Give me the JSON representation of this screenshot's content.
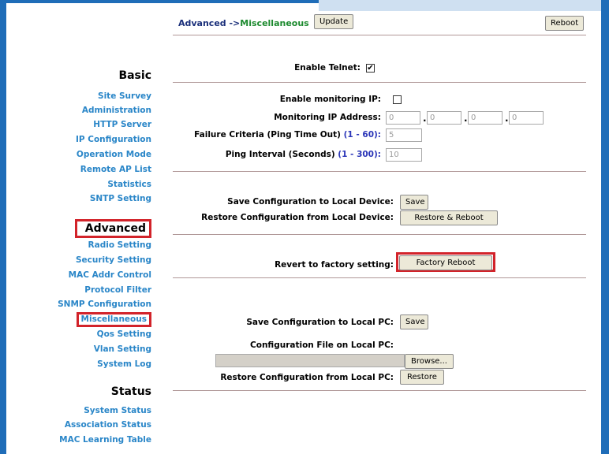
{
  "breadcrumb": {
    "section": "Advanced ->",
    "page": "Miscellaneous"
  },
  "buttons": {
    "update": "Update",
    "reboot": "Reboot",
    "save_local_device": "Save",
    "restore_reboot": "Restore & Reboot",
    "factory_reboot": "Factory Reboot",
    "save_local_pc": "Save",
    "browse": "Browse...",
    "restore": "Restore"
  },
  "sidebar": {
    "basic": {
      "title": "Basic",
      "items": [
        "Site Survey",
        "Administration",
        "HTTP Server",
        "IP Configuration",
        "Operation Mode",
        "Remote AP List",
        "Statistics",
        "SNTP Setting"
      ]
    },
    "advanced": {
      "title": "Advanced",
      "items": [
        "Radio Setting",
        "Security Setting",
        "MAC Addr Control",
        "Protocol Filter",
        "SNMP Configuration",
        "Miscellaneous",
        "Qos Setting",
        "Vlan Setting",
        "System Log"
      ]
    },
    "status": {
      "title": "Status",
      "items": [
        "System Status",
        "Association Status",
        "MAC Learning Table"
      ]
    }
  },
  "telnet": {
    "label": "Enable Telnet:",
    "checked": true,
    "mark": "✔"
  },
  "monitoring": {
    "enable_label": "Enable monitoring IP:",
    "enabled": false,
    "ip_label": "Monitoring IP Address:",
    "ip": [
      "0",
      "0",
      "0",
      "0"
    ],
    "failure_label": "Failure Criteria (Ping Time Out)",
    "failure_range": "(1 - 60):",
    "failure_value": "5",
    "interval_label": "Ping Interval (Seconds)",
    "interval_range": "(1 - 300):",
    "interval_value": "10"
  },
  "device_config": {
    "save_label": "Save Configuration to Local Device:",
    "restore_label": "Restore Configuration from Local Device:"
  },
  "factory": {
    "label": "Revert to factory setting:"
  },
  "pc_config": {
    "save_label": "Save Configuration to Local PC:",
    "file_label": "Configuration File on Local PC:",
    "file_value": "",
    "restore_label": "Restore Configuration from Local PC:"
  },
  "colors": {
    "frame": "#1f6db8",
    "link": "#2a86c8",
    "highlight": "#d2232a",
    "crumb_section": "#1a2f7a",
    "crumb_page": "#1c8a2e"
  }
}
